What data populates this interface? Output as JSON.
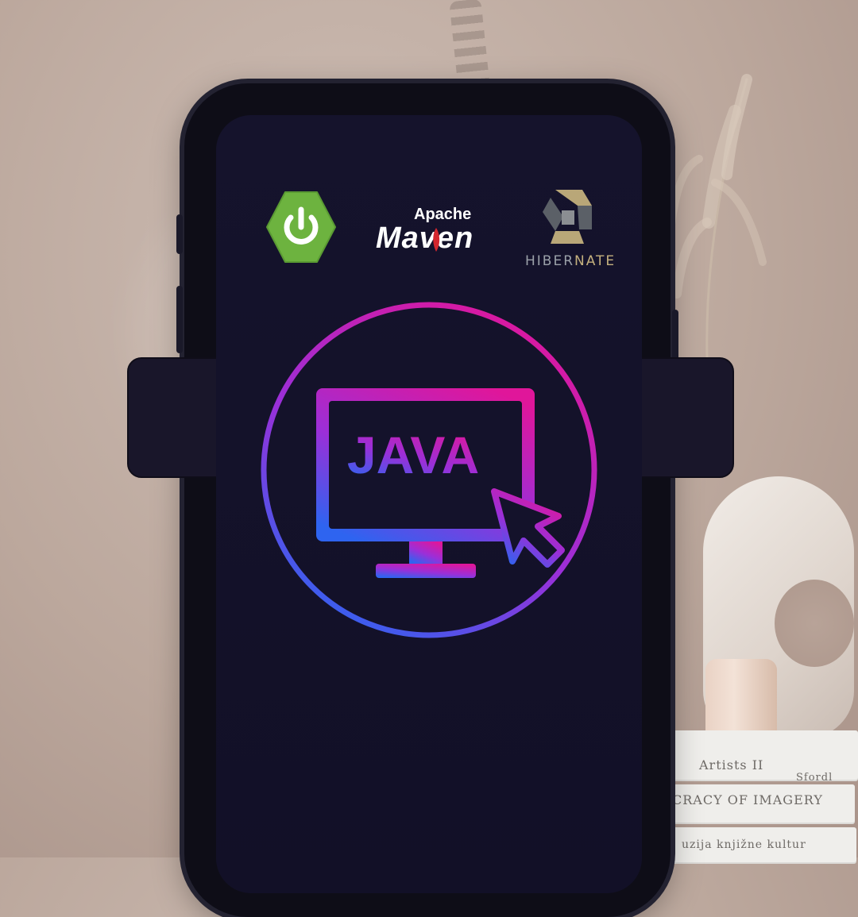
{
  "logos": {
    "spring": {
      "icon": "spring-power-icon",
      "color": "#6db33f"
    },
    "maven": {
      "apache": "Apache",
      "name": "Maven"
    },
    "hibernate": {
      "name_part1": "HIBER",
      "name_part2": "NATE"
    }
  },
  "emblem": {
    "label": "JAVA",
    "icons": [
      "monitor-icon",
      "cursor-arrow-icon"
    ],
    "gradient": [
      "#e0169a",
      "#9b2fd8",
      "#2e64f0"
    ]
  },
  "books": {
    "spine_1": "Artists II",
    "spine_1_side": "Sfordl",
    "spine_2": "CRACY OF IMAGERY",
    "spine_3": "uzija knjižne kultur"
  }
}
